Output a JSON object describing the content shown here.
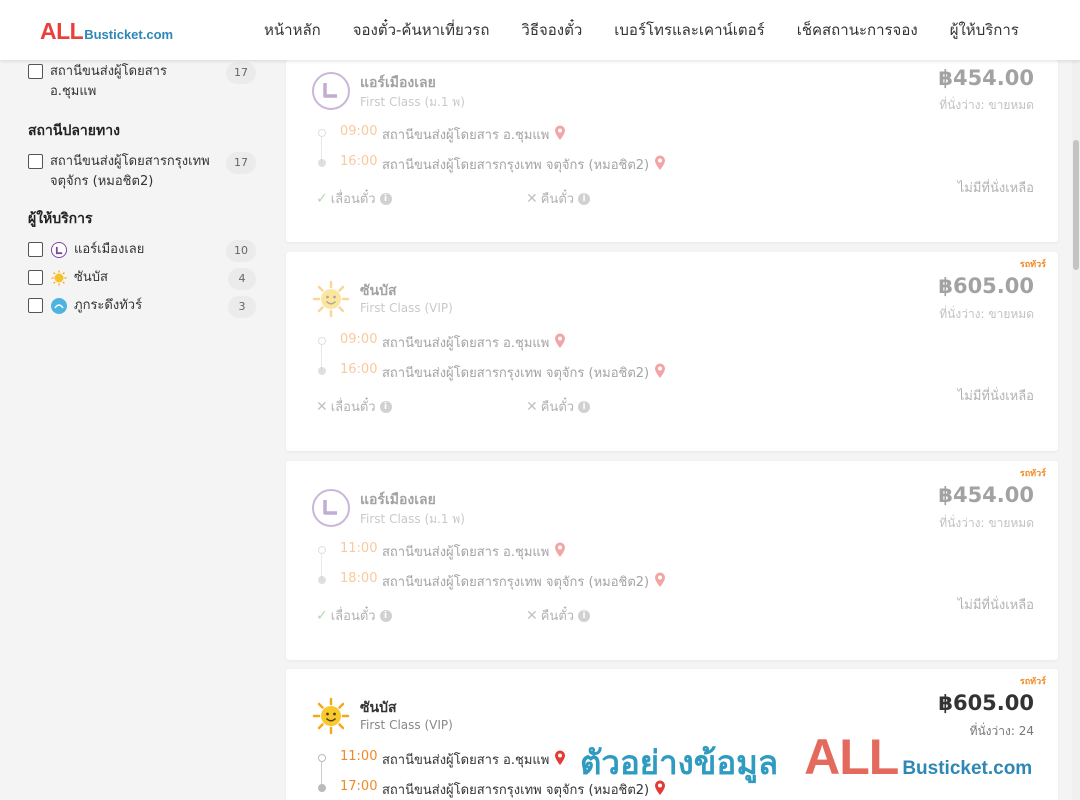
{
  "header": {
    "logo_all": "ALL",
    "logo_rest": "Busticket.com",
    "nav": [
      "หน้าหลัก",
      "จองตั๋ว-ค้นหาเที่ยวรถ",
      "วิธีจองตั๋ว",
      "เบอร์โทรและเคาน์เตอร์",
      "เช็คสถานะการจอง",
      "ผู้ให้บริการ"
    ]
  },
  "sidebar": {
    "origin_item": {
      "label": "สถานีขนส่งผู้โดยสาร อ.ชุมแพ",
      "count": "17"
    },
    "destination_title": "สถานีปลายทาง",
    "destination_item": {
      "label": "สถานีขนส่งผู้โดยสารกรุงเทพ จตุจักร (หมอชิต2)",
      "count": "17"
    },
    "operators_title": "ผู้ให้บริการ",
    "operators": [
      {
        "label": "แอร์เมืองเลย",
        "count": "10",
        "icon": "air-muanglei-icon"
      },
      {
        "label": "ซันบัส",
        "count": "4",
        "icon": "sun-icon"
      },
      {
        "label": "ภูกระดึงทัวร์",
        "count": "3",
        "icon": "phukradueng-icon"
      }
    ]
  },
  "cards": [
    {
      "tag": "",
      "operator": "แอร์เมืองเลย",
      "class": "First Class (ม.1 พ)",
      "price": "฿454.00",
      "seats": "ที่นั่งว่าง: ขายหมด",
      "depart_time": "09:00",
      "depart_station": "สถานีขนส่งผู้โดยสาร อ.ชุมแพ",
      "arrive_time": "16:00",
      "arrive_station": "สถานีขนส่งผู้โดยสารกรุงเทพ จตุจักร (หมอชิต2)",
      "reschedule": "เลื่อนตั๋ว",
      "refund": "คืนตั๋ว",
      "no_seats": "ไม่มีที่นั่งเหลือ"
    },
    {
      "tag": "รถทัวร์",
      "operator": "ซันบัส",
      "class": "First Class (VIP)",
      "price": "฿605.00",
      "seats": "ที่นั่งว่าง: ขายหมด",
      "depart_time": "09:00",
      "depart_station": "สถานีขนส่งผู้โดยสาร อ.ชุมแพ",
      "arrive_time": "16:00",
      "arrive_station": "สถานีขนส่งผู้โดยสารกรุงเทพ จตุจักร (หมอชิต2)",
      "reschedule": "เลื่อนตั๋ว",
      "refund": "คืนตั๋ว",
      "no_seats": "ไม่มีที่นั่งเหลือ"
    },
    {
      "tag": "รถทัวร์",
      "operator": "แอร์เมืองเลย",
      "class": "First Class (ม.1 พ)",
      "price": "฿454.00",
      "seats": "ที่นั่งว่าง: ขายหมด",
      "depart_time": "11:00",
      "depart_station": "สถานีขนส่งผู้โดยสาร อ.ชุมแพ",
      "arrive_time": "18:00",
      "arrive_station": "สถานีขนส่งผู้โดยสารกรุงเทพ จตุจักร (หมอชิต2)",
      "reschedule": "เลื่อนตั๋ว",
      "refund": "คืนตั๋ว",
      "no_seats": "ไม่มีที่นั่งเหลือ"
    },
    {
      "tag": "รถทัวร์",
      "operator": "ซันบัส",
      "class": "First Class (VIP)",
      "price": "฿605.00",
      "seats": "ที่นั่งว่าง: 24",
      "depart_time": "11:00",
      "depart_station": "สถานีขนส่งผู้โดยสาร อ.ชุมแพ",
      "arrive_time": "17:00",
      "arrive_station": "สถานีขนส่งผู้โดยสารกรุงเทพ จตุจักร (หมอชิต2)"
    }
  ],
  "watermark": {
    "text": "ตัวอย่างข้อมูล",
    "all": "ALL",
    "rest": "Busticket.com"
  },
  "colors": {
    "accent_orange": "#f08a24",
    "brand_red": "#e8413d",
    "brand_blue": "#2d87b8",
    "pin_red": "#e53935",
    "check_green": "#4caf50"
  }
}
